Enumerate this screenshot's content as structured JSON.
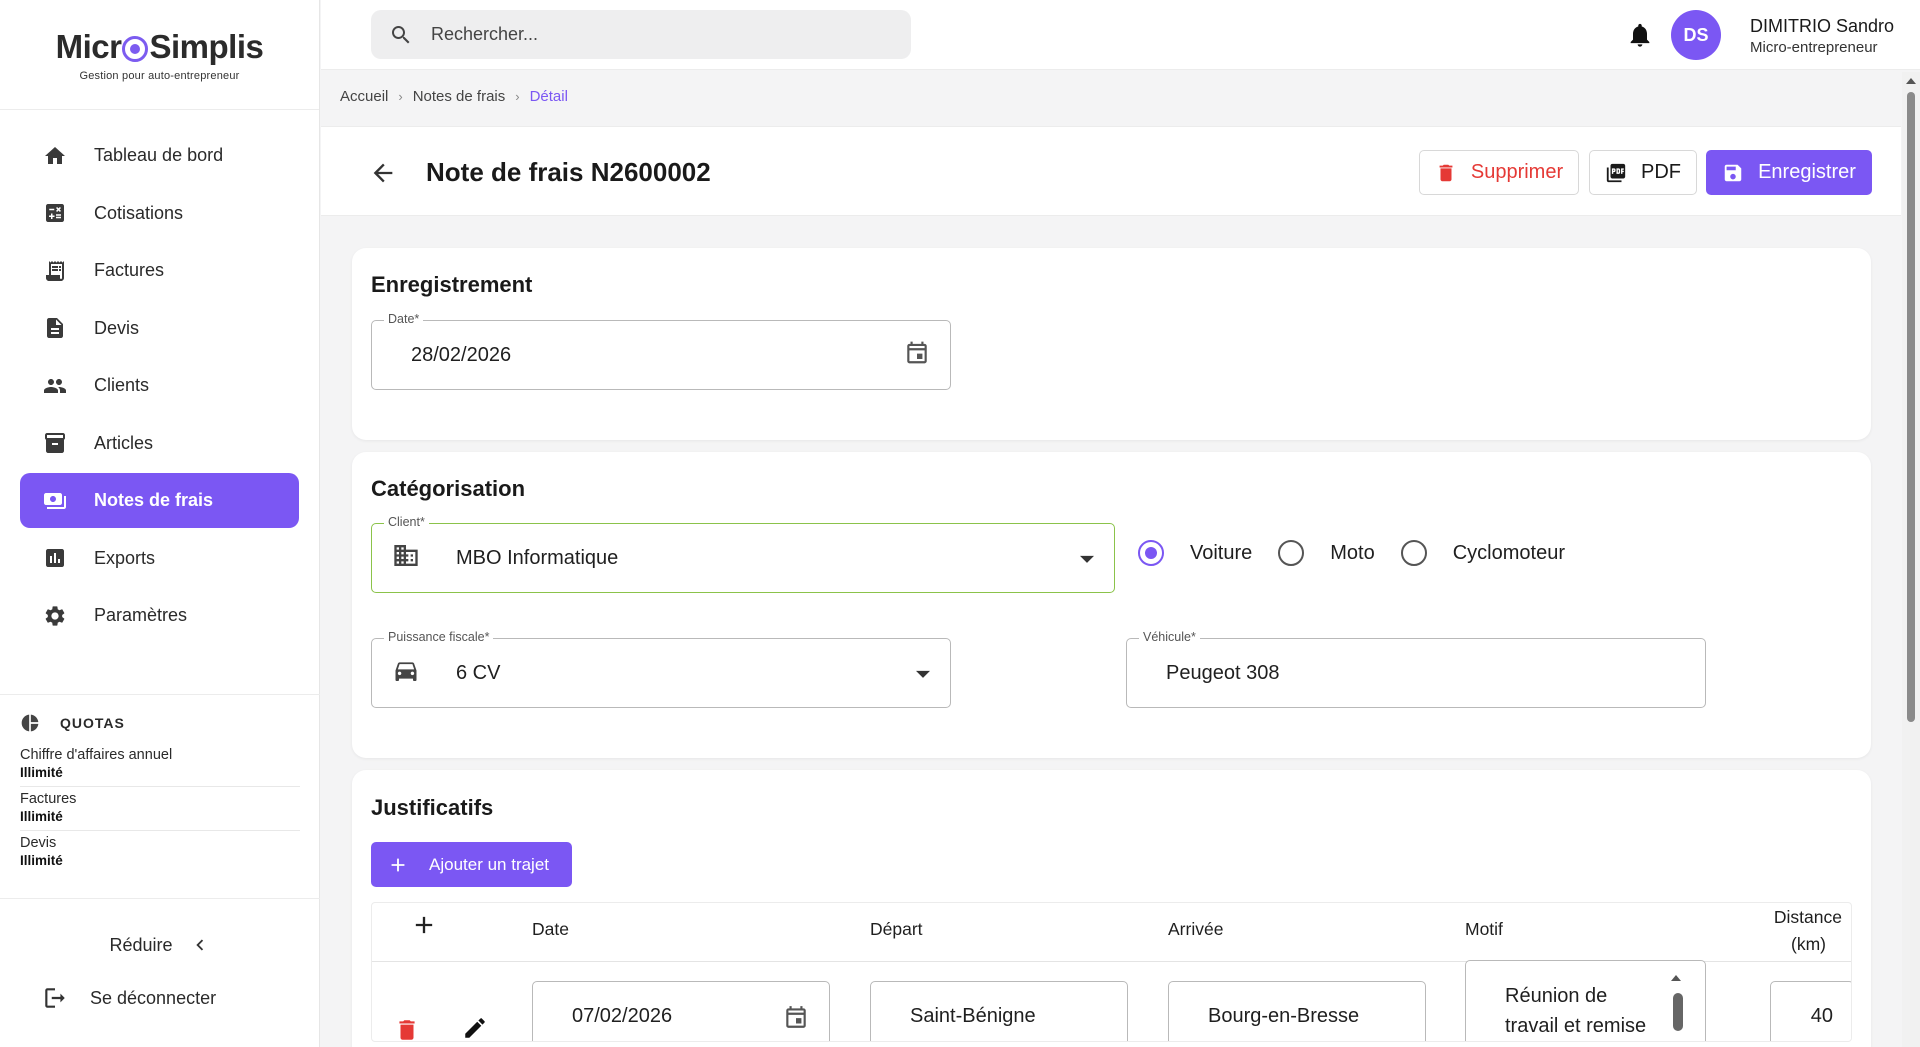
{
  "app": {
    "logo_left": "Micr",
    "logo_right": "Simplis",
    "tagline": "Gestion pour auto-entrepreneur"
  },
  "sidebar": {
    "items": [
      {
        "label": "Tableau de bord",
        "icon": "home-icon"
      },
      {
        "label": "Cotisations",
        "icon": "calculator-icon"
      },
      {
        "label": "Factures",
        "icon": "receipt-icon"
      },
      {
        "label": "Devis",
        "icon": "document-icon"
      },
      {
        "label": "Clients",
        "icon": "people-icon"
      },
      {
        "label": "Articles",
        "icon": "archive-icon"
      },
      {
        "label": "Notes de frais",
        "icon": "money-icon",
        "active": true
      },
      {
        "label": "Exports",
        "icon": "chart-icon"
      },
      {
        "label": "Paramètres",
        "icon": "gear-icon"
      }
    ],
    "quotas": {
      "title": "QUOTAS",
      "items": [
        {
          "label": "Chiffre d'affaires annuel",
          "value": "Illimité"
        },
        {
          "label": "Factures",
          "value": "Illimité"
        },
        {
          "label": "Devis",
          "value": "Illimité"
        }
      ]
    },
    "reduce_label": "Réduire",
    "logout_label": "Se déconnecter"
  },
  "topbar": {
    "search_placeholder": "Rechercher...",
    "avatar_initials": "DS",
    "user_name": "DIMITRIO Sandro",
    "user_role": "Micro-entrepreneur"
  },
  "breadcrumb": [
    "Accueil",
    "Notes de frais",
    "Détail"
  ],
  "header": {
    "title": "Note de frais N2600002",
    "delete_label": "Supprimer",
    "pdf_label": "PDF",
    "save_label": "Enregistrer"
  },
  "enregistrement": {
    "title": "Enregistrement",
    "date_label": "Date*",
    "date_value": "28/02/2026"
  },
  "categorisation": {
    "title": "Catégorisation",
    "client_label": "Client*",
    "client_value": "MBO Informatique",
    "vehicle_types": [
      "Voiture",
      "Moto",
      "Cyclomoteur"
    ],
    "vehicle_type_selected": "Voiture",
    "puissance_label": "Puissance fiscale*",
    "puissance_value": "6 CV",
    "vehicule_label": "Véhicule*",
    "vehicule_value": "Peugeot 308"
  },
  "justificatifs": {
    "title": "Justificatifs",
    "add_label": "Ajouter un trajet",
    "columns": {
      "date": "Date",
      "depart": "Départ",
      "arrivee": "Arrivée",
      "motif": "Motif",
      "distance_1": "Distance",
      "distance_2": "(km)"
    },
    "rows": [
      {
        "date": "07/02/2026",
        "depart": "Saint-Bénigne",
        "arrivee": "Bourg-en-Bresse",
        "motif_1": "Réunion de",
        "motif_2": "travail et remise",
        "distance": "40"
      }
    ]
  },
  "colors": {
    "accent": "#7b57f3",
    "danger": "#e53935",
    "valid": "#8bc34a"
  }
}
